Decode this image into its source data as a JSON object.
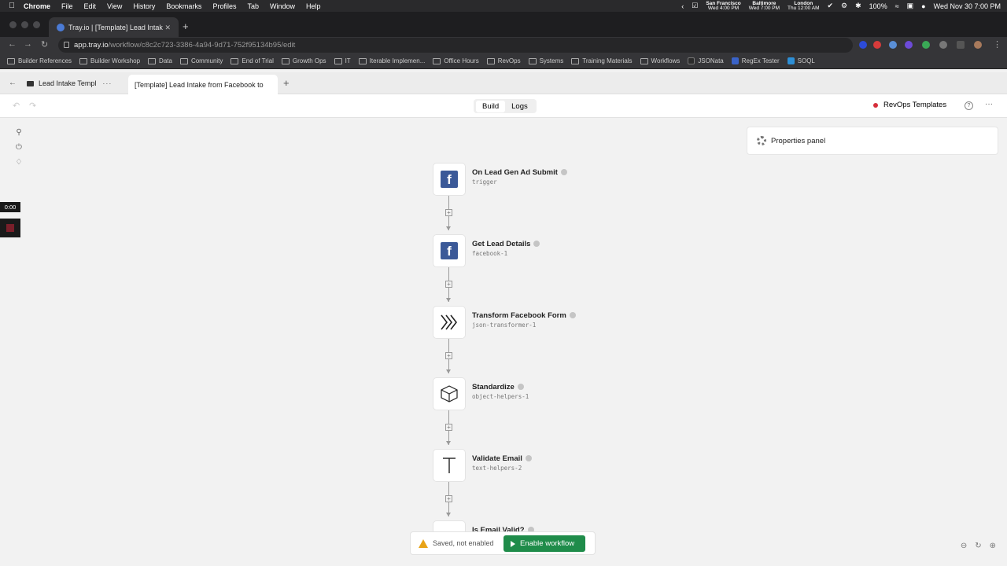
{
  "menubar": {
    "app": "Chrome",
    "items": [
      "File",
      "Edit",
      "View",
      "History",
      "Bookmarks",
      "Profiles",
      "Tab",
      "Window",
      "Help"
    ],
    "clocks": [
      {
        "city": "San Francisco",
        "time": "Wed 4:00 PM"
      },
      {
        "city": "Baltimore",
        "time": "Wed 7:00 PM"
      },
      {
        "city": "London",
        "time": "Thu 12:00 AM"
      }
    ],
    "battery": "100%",
    "datetime": "Wed Nov 30  7:00 PM"
  },
  "browser": {
    "tab_title": "Tray.io | [Template] Lead Intak",
    "url_host": "app.tray.io",
    "url_path": "/workflow/c8c2c723-3386-4a94-9d71-752f95134b95/edit",
    "bookmarks": [
      {
        "label": "Builder References",
        "type": "folder"
      },
      {
        "label": "Builder Workshop",
        "type": "folder"
      },
      {
        "label": "Data",
        "type": "folder"
      },
      {
        "label": "Community",
        "type": "folder"
      },
      {
        "label": "End of Trial",
        "type": "folder"
      },
      {
        "label": "Growth Ops",
        "type": "folder"
      },
      {
        "label": "IT",
        "type": "folder"
      },
      {
        "label": "Iterable Implemen...",
        "type": "folder"
      },
      {
        "label": "Office Hours",
        "type": "folder"
      },
      {
        "label": "RevOps",
        "type": "folder"
      },
      {
        "label": "Systems",
        "type": "folder"
      },
      {
        "label": "Training Materials",
        "type": "folder"
      },
      {
        "label": "Workflows",
        "type": "folder"
      },
      {
        "label": "JSONata",
        "type": "link"
      },
      {
        "label": "RegEx Tester",
        "type": "link"
      },
      {
        "label": "SOQL",
        "type": "link"
      }
    ]
  },
  "app": {
    "tab1": "Lead Intake Templ",
    "tab2": "[Template] Lead Intake from Facebook to",
    "view_build": "Build",
    "view_logs": "Logs",
    "project": "RevOps Templates",
    "properties_panel": "Properties panel",
    "recording_time": "0:00",
    "status_text": "Saved, not enabled",
    "enable_label": "Enable workflow",
    "brand_green": "#1f8c4a",
    "steps": [
      {
        "title": "On Lead Gen Ad Submit",
        "id": "trigger",
        "icon": "facebook-icon"
      },
      {
        "title": "Get Lead Details",
        "id": "facebook-1",
        "icon": "facebook-icon"
      },
      {
        "title": "Transform Facebook Form",
        "id": "json-transformer-1",
        "icon": "transformer-icon"
      },
      {
        "title": "Standardize",
        "id": "object-helpers-1",
        "icon": "cube-icon"
      },
      {
        "title": "Validate Email",
        "id": "text-helpers-2",
        "icon": "text-icon"
      },
      {
        "title": "Is Email Valid?",
        "id": "",
        "icon": "boolean-icon"
      }
    ]
  }
}
